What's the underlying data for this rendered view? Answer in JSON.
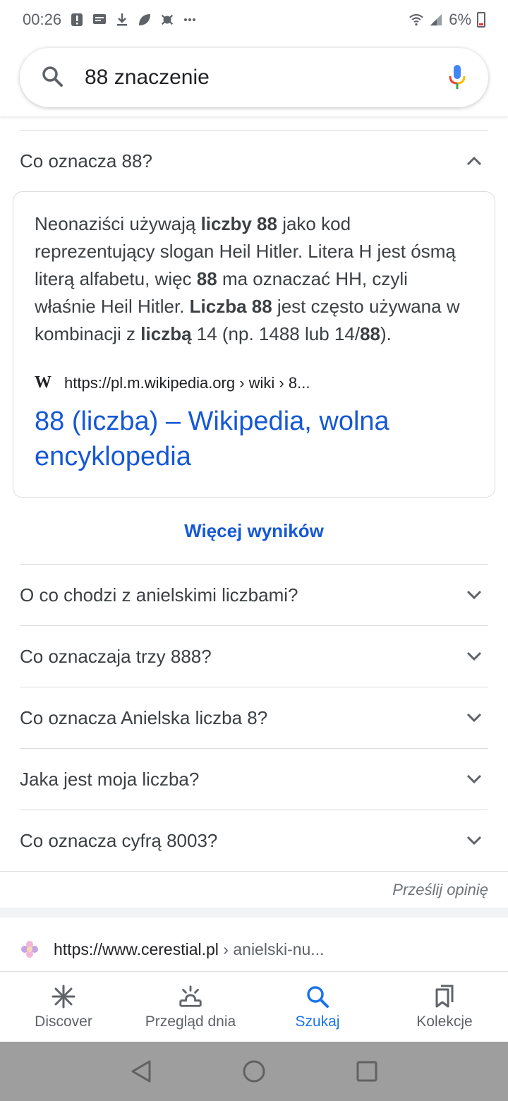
{
  "status": {
    "time": "00:26",
    "battery": "6%"
  },
  "search": {
    "query": "88 znaczenie"
  },
  "faq": {
    "expanded_question": "Co oznacza 88?",
    "answer_parts": [
      {
        "t": "Neonaziści używają ",
        "b": false
      },
      {
        "t": "liczby 88",
        "b": true
      },
      {
        "t": " jako kod reprezentujący slogan Heil Hitler. Litera H jest ósmą literą alfabetu, więc ",
        "b": false
      },
      {
        "t": "88",
        "b": true
      },
      {
        "t": " ma oznaczać HH, czyli właśnie Heil Hitler. ",
        "b": false
      },
      {
        "t": "Liczba 88",
        "b": true
      },
      {
        "t": " jest często używana w kombinacji z ",
        "b": false
      },
      {
        "t": "liczbą",
        "b": true
      },
      {
        "t": " 14 (np. 1488 lub 14/",
        "b": false
      },
      {
        "t": "88",
        "b": true
      },
      {
        "t": ").",
        "b": false
      }
    ],
    "source_url": "https://pl.m.wikipedia.org › wiki › 8...",
    "result_title": "88 (liczba) – Wikipedia, wolna encyklopedia",
    "more_results": "Więcej wyników",
    "other_questions": [
      "O co chodzi z anielskimi liczbami?",
      "Co oznaczaja trzy 888?",
      "Co oznacza Anielska liczba 8?",
      "Jaka jest moja liczba?",
      "Co oznacza cyfrą 8003?"
    ],
    "feedback": "Prześlij opinię"
  },
  "next_result": {
    "domain": "https://www.cerestial.pl",
    "path": " › anielski-nu..."
  },
  "bottom_nav": {
    "items": [
      "Discover",
      "Przegląd dnia",
      "Szukaj",
      "Kolekcje"
    ]
  },
  "colors": {
    "link": "#1558d6",
    "active_tab": "#1a73e8"
  }
}
